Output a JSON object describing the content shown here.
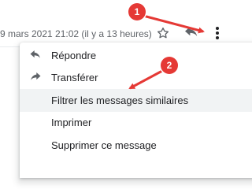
{
  "header": {
    "timestamp": "9 mars 2021 21:02 (il y a 13 heures)",
    "icons": [
      "star-icon",
      "reply-icon",
      "more-vert-icon"
    ]
  },
  "menu": {
    "items": [
      {
        "label": "Répondre",
        "icon": "reply-icon"
      },
      {
        "label": "Transférer",
        "icon": "forward-icon"
      },
      {
        "label": "Filtrer les messages similaires",
        "icon": ""
      },
      {
        "label": "Imprimer",
        "icon": ""
      },
      {
        "label": "Supprimer ce message",
        "icon": ""
      }
    ]
  },
  "annotations": {
    "callout_1": "1",
    "callout_2": "2",
    "color": "#e53935"
  },
  "colors": {
    "icon": "#5f6368",
    "highlight": "#f1f3f4"
  }
}
